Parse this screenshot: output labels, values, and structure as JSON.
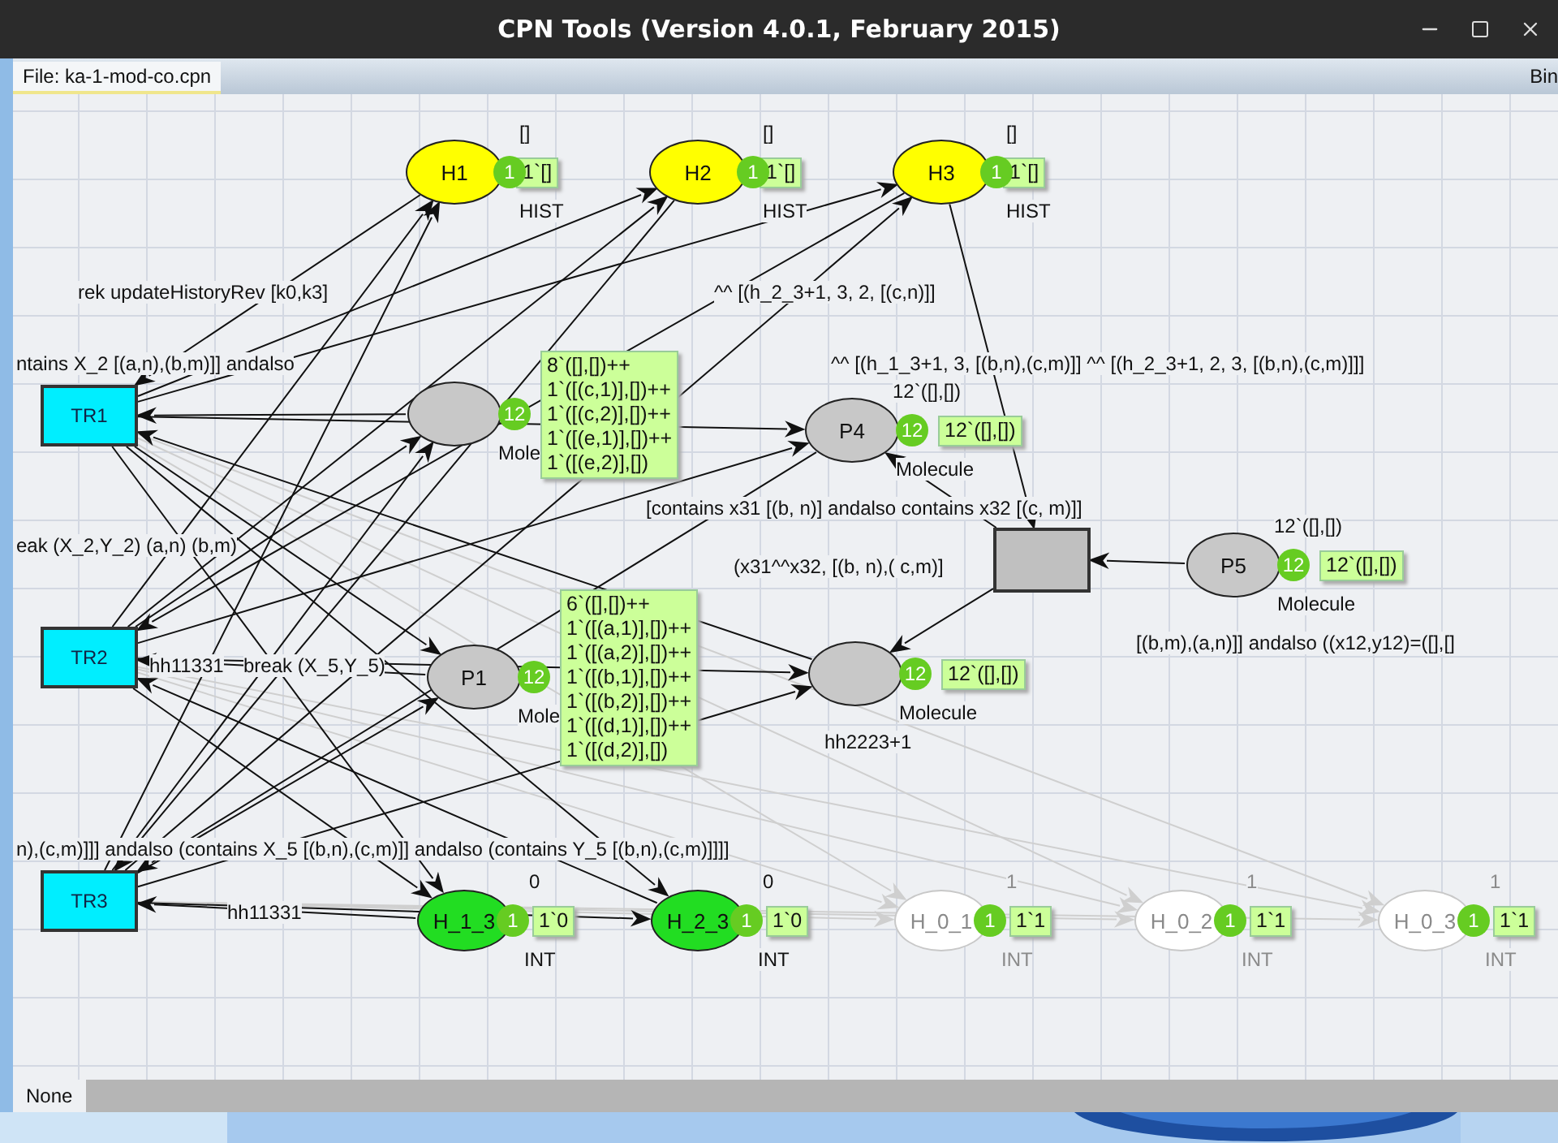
{
  "window": {
    "title": "CPN Tools (Version 4.0.1, February 2015)"
  },
  "file_tab": {
    "label": "File:  ka-1-mod-co.cpn",
    "selected": true
  },
  "bin_label": "Bin",
  "places": [
    {
      "kind": "hist",
      "name": "H1",
      "tokens": "1",
      "marking": [
        "1`[]"
      ],
      "initial": "[]",
      "type": "HIST",
      "dimmed": false
    },
    {
      "kind": "hist",
      "name": "H2",
      "tokens": "1",
      "marking": [
        "1`[]"
      ],
      "initial": "[]",
      "type": "HIST",
      "dimmed": false
    },
    {
      "kind": "hist",
      "name": "H3",
      "tokens": "1",
      "marking": [
        "1`[]"
      ],
      "initial": "[]",
      "type": "HIST",
      "dimmed": false
    },
    {
      "kind": "molecule",
      "tokens": "12",
      "marking": [
        "8`([],[])++",
        "1`([(c,1)],[])++",
        "1`([(c,2)],[])++",
        "1`([(e,1)],[])++",
        "1`([(e,2)],[])"
      ],
      "type": "Mole",
      "dimmed": false
    },
    {
      "kind": "molecule",
      "name": "P4",
      "tokens": "12",
      "marking": [
        "12`([],[])"
      ],
      "initial": "12`([],[])",
      "type": "Molecule",
      "dimmed": false
    },
    {
      "kind": "molecule",
      "name": "P5",
      "tokens": "12",
      "marking": [
        "12`([],[])"
      ],
      "initial": "12`([],[])",
      "type": "Molecule",
      "dimmed": false
    },
    {
      "kind": "molecule",
      "name": "P1",
      "tokens": "12",
      "marking": [
        "6`([],[])++",
        "1`([(a,1)],[])++",
        "1`([(a,2)],[])++",
        "1`([(b,1)],[])++",
        "1`([(b,2)],[])++",
        "1`([(d,1)],[])++",
        "1`([(d,2)],[])"
      ],
      "type": "Mole",
      "dimmed": false
    },
    {
      "kind": "molecule",
      "tokens": "12",
      "marking": [
        "12`([],[])"
      ],
      "type": "Molecule",
      "dimmed": false
    },
    {
      "kind": "int",
      "name": "H_1_3",
      "tokens": "1",
      "marking": [
        "1`0"
      ],
      "initial": "0",
      "type": "INT",
      "dimmed": false
    },
    {
      "kind": "int",
      "name": "H_2_3",
      "tokens": "1",
      "marking": [
        "1`0"
      ],
      "initial": "0",
      "type": "INT",
      "dimmed": false
    },
    {
      "kind": "int",
      "name": "H_0_1",
      "tokens": "1",
      "marking": [
        "1`1"
      ],
      "initial": "1",
      "type": "INT",
      "dimmed": true
    },
    {
      "kind": "int",
      "name": "H_0_2",
      "tokens": "1",
      "marking": [
        "1`1"
      ],
      "initial": "1",
      "type": "INT",
      "dimmed": true
    },
    {
      "kind": "int",
      "name": "H_0_3",
      "tokens": "1",
      "marking": [
        "1`1"
      ],
      "initial": "1",
      "type": "INT",
      "dimmed": true
    }
  ],
  "transitions": [
    {
      "kind": "enabled",
      "name": "TR1"
    },
    {
      "kind": "enabled",
      "name": "TR2"
    },
    {
      "kind": "enabled",
      "name": "TR3"
    },
    {
      "kind": "plain"
    }
  ],
  "inscriptions": [
    "rek updateHistoryRev [k0,k3]",
    "^^ [(h_2_3+1, 3, 2, [(c,n)]]",
    "ntains X_2 [(a,n),(b,m)]] andalso",
    "^^ [(h_1_3+1, 3, [(b,n),(c,m)]] ^^ [(h_2_3+1, 2, 3, [(b,n),(c,m)]]]",
    "[contains x31 [(b, n)] andalso contains x32 [(c, m)]]",
    "(x31^^x32, [(b, n),( c,m)]",
    "eak (X_2,Y_2) (a,n) (b,m)",
    "[(b,m),(a,n)]] andalso ((x12,y12)=([],[]",
    "hh11331",
    "break (X_5,Y_5)",
    "hh2223+1",
    "n),(c,m)]]] andalso (contains X_5 [(b,n),(c,m)]] andalso (contains Y_5 [(b,n),(c,m)]]]]",
    "hh11331"
  ],
  "bottom_tab": {
    "label": "None",
    "selected": true
  }
}
